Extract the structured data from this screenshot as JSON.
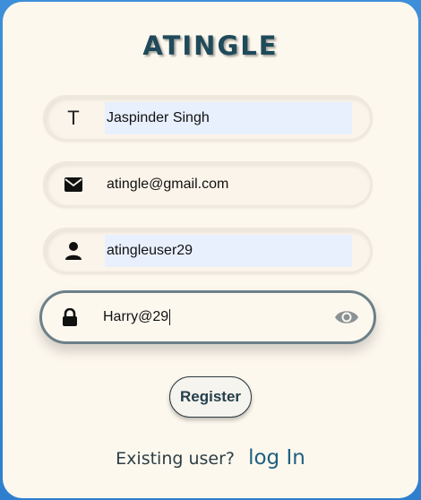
{
  "brand": {
    "title": "ATINGLE"
  },
  "form": {
    "name": {
      "icon": "text-t-icon",
      "glyph": "T",
      "value": "Jaspinder Singh"
    },
    "email": {
      "icon": "envelope-icon",
      "value": "atingle@gmail.com"
    },
    "username": {
      "icon": "user-icon",
      "value": "atingleuser29"
    },
    "password": {
      "icon": "lock-icon",
      "value": "Harry@29",
      "toggle_icon": "eye-icon"
    }
  },
  "actions": {
    "register_label": "Register"
  },
  "footer": {
    "existing_text": "Existing user?",
    "login_link": "log In"
  },
  "colors": {
    "background": "#2f7fcf",
    "card": "#fdf8ee",
    "brand": "#1f4a5a",
    "link": "#1f6080",
    "autofill": "#e8f0fe"
  }
}
